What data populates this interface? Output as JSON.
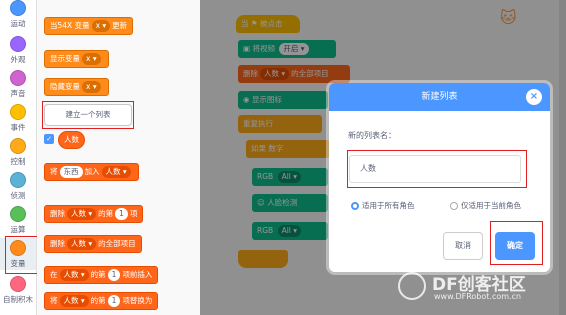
{
  "categories": [
    {
      "label": "运动",
      "color": "#4c97ff"
    },
    {
      "label": "外观",
      "color": "#9966ff"
    },
    {
      "label": "声音",
      "color": "#cf63cf"
    },
    {
      "label": "事件",
      "color": "#ffbf00"
    },
    {
      "label": "控制",
      "color": "#ffab19"
    },
    {
      "label": "侦测",
      "color": "#5cb1d6"
    },
    {
      "label": "运算",
      "color": "#59c059"
    },
    {
      "label": "变量",
      "color": "#ff8c1a"
    },
    {
      "label": "自制积木",
      "color": "#ff6680"
    }
  ],
  "palette": {
    "set_block": {
      "part1": "当54X 变量",
      "drop": "x ▾",
      "part2": "更新"
    },
    "show_var": {
      "part1": "显示变量",
      "drop": "x ▾"
    },
    "hide_var": {
      "part1": "隐藏变量",
      "drop": "x ▾"
    },
    "make_list_button": "建立一个列表",
    "list_reporter": "人数",
    "add_block": {
      "p1": "将",
      "thing": "东西",
      "p2": "加入",
      "list": "人数 ▾"
    },
    "delete_block": {
      "p1": "删除",
      "list": "人数 ▾",
      "p2": "的第",
      "num": "1",
      "p3": "项"
    },
    "delete_all_block": {
      "p1": "删除",
      "list": "人数 ▾",
      "p2": "的全部项目"
    },
    "insert_block": {
      "p1": "在",
      "list": "人数 ▾",
      "p2": "的第",
      "num": "1",
      "p3": "项前插入"
    },
    "replace_block": {
      "p1": "将",
      "list": "人数 ▾",
      "p2": "的第",
      "num": "1",
      "p3": "项替换为"
    }
  },
  "script": {
    "hat": "当 ⚑ 被点击",
    "video": {
      "p1": "将视频",
      "drop": "开启 ▾"
    },
    "delete_all": {
      "p1": "删除",
      "list": "人数 ▾",
      "p2": "的全部项目"
    },
    "show_image": "显示图标",
    "forever": "重复执行",
    "if_label": "如果",
    "num_label": "数字",
    "rgb1": "RGB",
    "rgb1_drop": "All ▾",
    "detect": "人脸检测",
    "rgb2": "RGB",
    "rgb2_drop": "All ▾"
  },
  "dialog": {
    "title": "新建列表",
    "close": "×",
    "name_label": "新的列表名：",
    "name_value": "人数",
    "radio_all": "适用于所有角色",
    "radio_current": "仅适用于当前角色",
    "cancel": "取消",
    "ok": "确定"
  },
  "watermark": {
    "title": "DF创客社区",
    "url": "www.DFRobot.com.cn"
  }
}
